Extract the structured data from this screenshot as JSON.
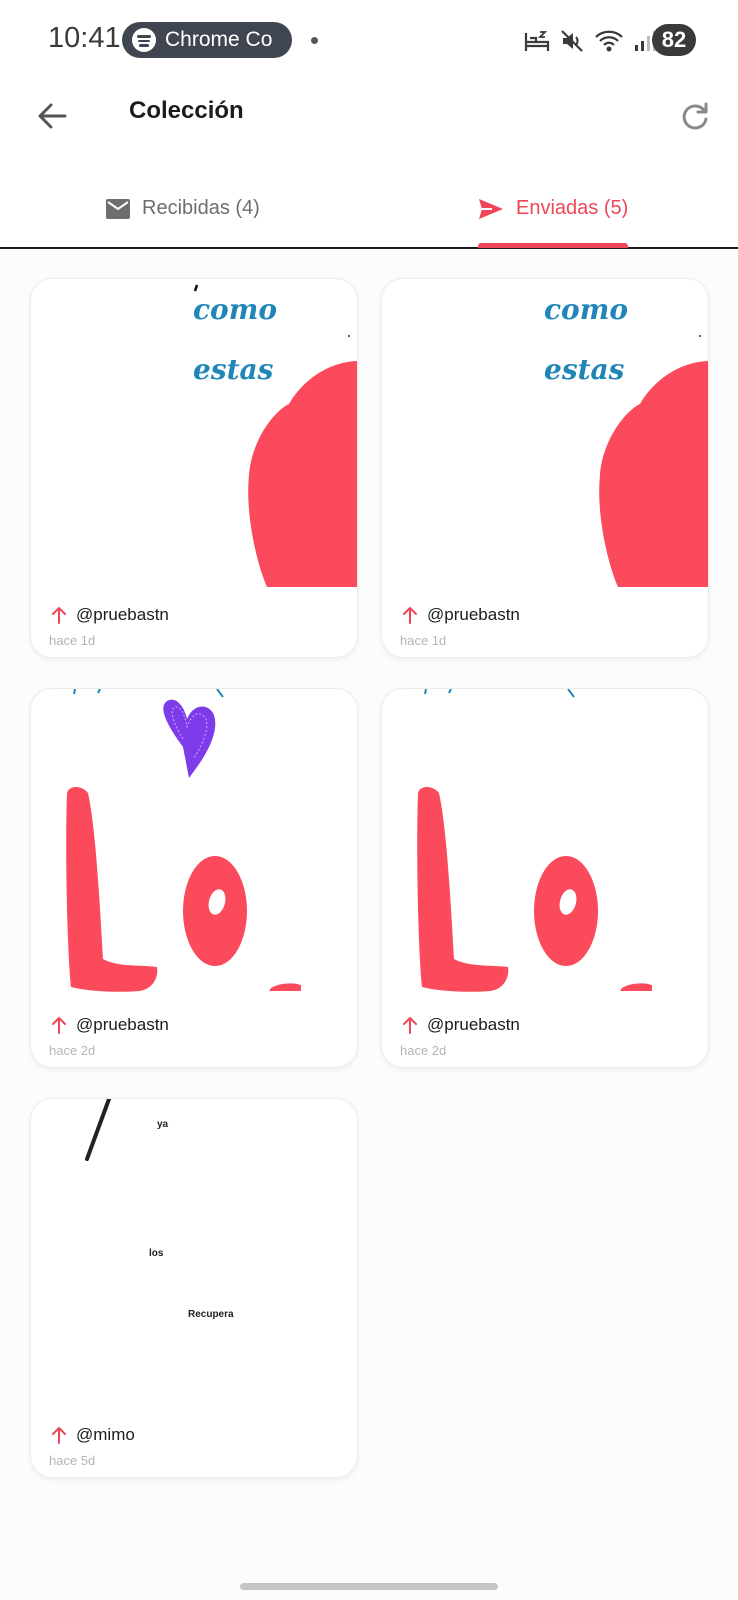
{
  "status_bar": {
    "time": "10:41",
    "notification_app": "Chrome Co",
    "battery": "82"
  },
  "header": {
    "title": "Colección",
    "back_icon": "arrow-left-icon",
    "refresh_icon": "refresh-icon"
  },
  "tabs": [
    {
      "label": "Recibidas (4)",
      "icon": "mail-icon",
      "selected": false
    },
    {
      "label": "Enviadas (5)",
      "icon": "send-icon",
      "selected": true
    }
  ],
  "colors": {
    "accent": "#ee4657",
    "drawing_red": "#fb4a5c",
    "drawing_blue": "#1f86b7",
    "drawing_purple": "#7d3bea"
  },
  "cards": [
    {
      "user": "@pruebastn",
      "time": "hace 1d",
      "drawing_text": [
        "como",
        "estas"
      ]
    },
    {
      "user": "@pruebastn",
      "time": "hace 1d",
      "drawing_text": [
        "como",
        "estas"
      ]
    },
    {
      "user": "@pruebastn",
      "time": "hace 2d",
      "drawing_text": []
    },
    {
      "user": "@pruebastn",
      "time": "hace 2d",
      "drawing_text": []
    },
    {
      "user": "@mimo",
      "time": "hace 5d",
      "drawing_text": [
        "ya",
        "los",
        "Recupera"
      ]
    }
  ]
}
